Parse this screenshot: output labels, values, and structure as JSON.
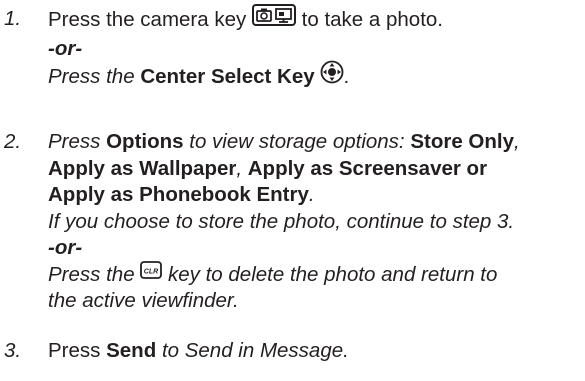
{
  "steps": [
    {
      "number": "1.",
      "lines": {
        "a_pre": "Press the camera key",
        "a_post": "to take a photo.",
        "or": "-or-",
        "c_pre": "Press the",
        "c_bold": "Center Select Key",
        "c_post": "."
      },
      "icons": [
        "camera-key-icon",
        "center-select-key-icon"
      ]
    },
    {
      "number": "2.",
      "lines": {
        "a_pre": "Press",
        "a_bold1": "Options",
        "a_mid": "to view storage options:",
        "a_bold2": "Store Only",
        "a_comma": ",",
        "b_bold1": "Apply as Wallpaper",
        "b_comma": ",",
        "b_bold2": "Apply as Screensaver or",
        "c_bold": "Apply as Phonebook Entry",
        "c_post": ".",
        "d": "If you choose to store the photo, continue to step 3.",
        "or": "-or-",
        "f_pre": "Press the",
        "f_post": "key to delete the photo and return to",
        "g": "the active viewfinder."
      },
      "icons": [
        "clr-key-icon"
      ]
    },
    {
      "number": "3.",
      "lines": {
        "a_pre": "Press",
        "a_bold": "Send",
        "a_post": "to Send in Message."
      }
    }
  ],
  "colors": {
    "text": "#231f20",
    "background": "#ffffff"
  }
}
